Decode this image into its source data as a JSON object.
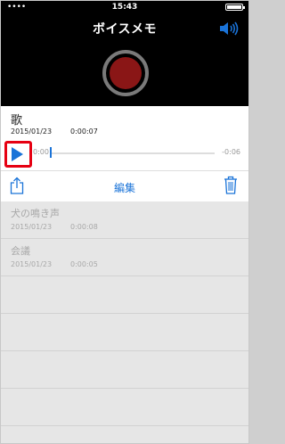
{
  "status": {
    "carrier": "••••",
    "time": "15:43"
  },
  "nav": {
    "title": "ボイスメモ"
  },
  "selected": {
    "title": "歌",
    "date": "2015/01/23",
    "duration": "0:00:07",
    "current_time": "0:00",
    "remaining_time": "-0:06",
    "progress": 0
  },
  "toolbar": {
    "edit_label": "編集"
  },
  "memos": [
    {
      "title": "犬の鳴き声",
      "date": "2015/01/23",
      "duration": "0:00:08"
    },
    {
      "title": "会議",
      "date": "2015/01/23",
      "duration": "0:00:05"
    }
  ],
  "colors": {
    "accent": "#1a73d8",
    "highlight": "#e60012",
    "record": "#8a1616"
  }
}
